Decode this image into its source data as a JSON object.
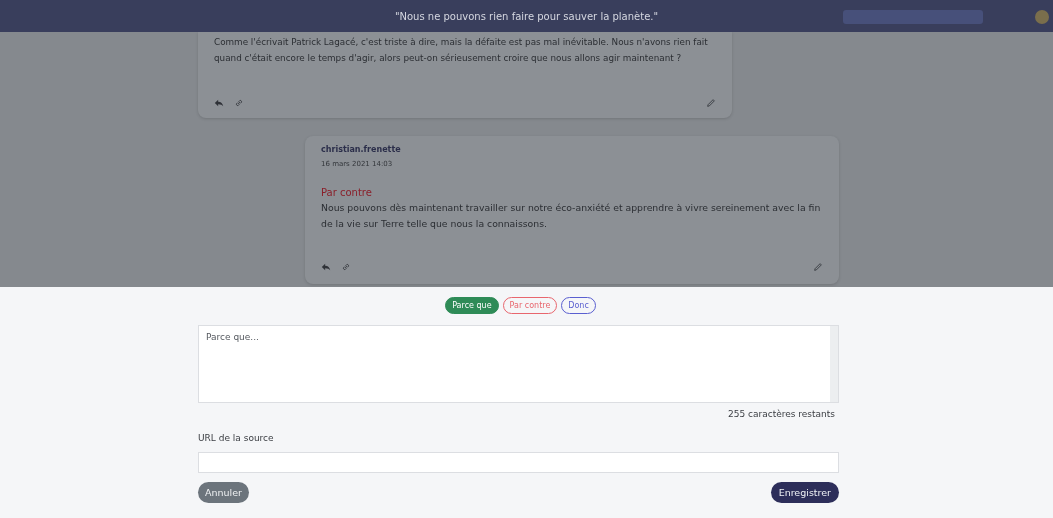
{
  "header": {
    "title": "\"Nous ne pouvons rien faire pour sauver la planète.\""
  },
  "comments": [
    {
      "lines": [
        "Comme l'écrivait Patrick Lagacé, c'est triste à dire, mais la défaite est pas mal inévitable. Nous n'avons rien fait",
        "quand c'était encore le temps d'agir, alors peut-on sérieusement croire que nous allons agir maintenant ?"
      ]
    },
    {
      "author": "christian.frenette",
      "date": "16 mars 2021 14:03",
      "connector": "Par contre",
      "text": "Nous pouvons dès maintenant travailler sur notre éco-anxiété et apprendre à vivre sereinement avec la fin de la vie sur Terre telle que nous la connaissons."
    }
  ],
  "form": {
    "tags": [
      {
        "label": "Parce que",
        "color": "#2e8b57",
        "selected": true
      },
      {
        "label": "Par contre",
        "color": "#e8666e",
        "selected": false
      },
      {
        "label": "Donc",
        "color": "#5a5fd0",
        "selected": false
      }
    ],
    "message": {
      "placeholder": "Parce que..."
    },
    "remaining": "255 caractères restants",
    "source_label": "URL de la source",
    "cancel": "Annuler",
    "save": "Enregistrer"
  }
}
